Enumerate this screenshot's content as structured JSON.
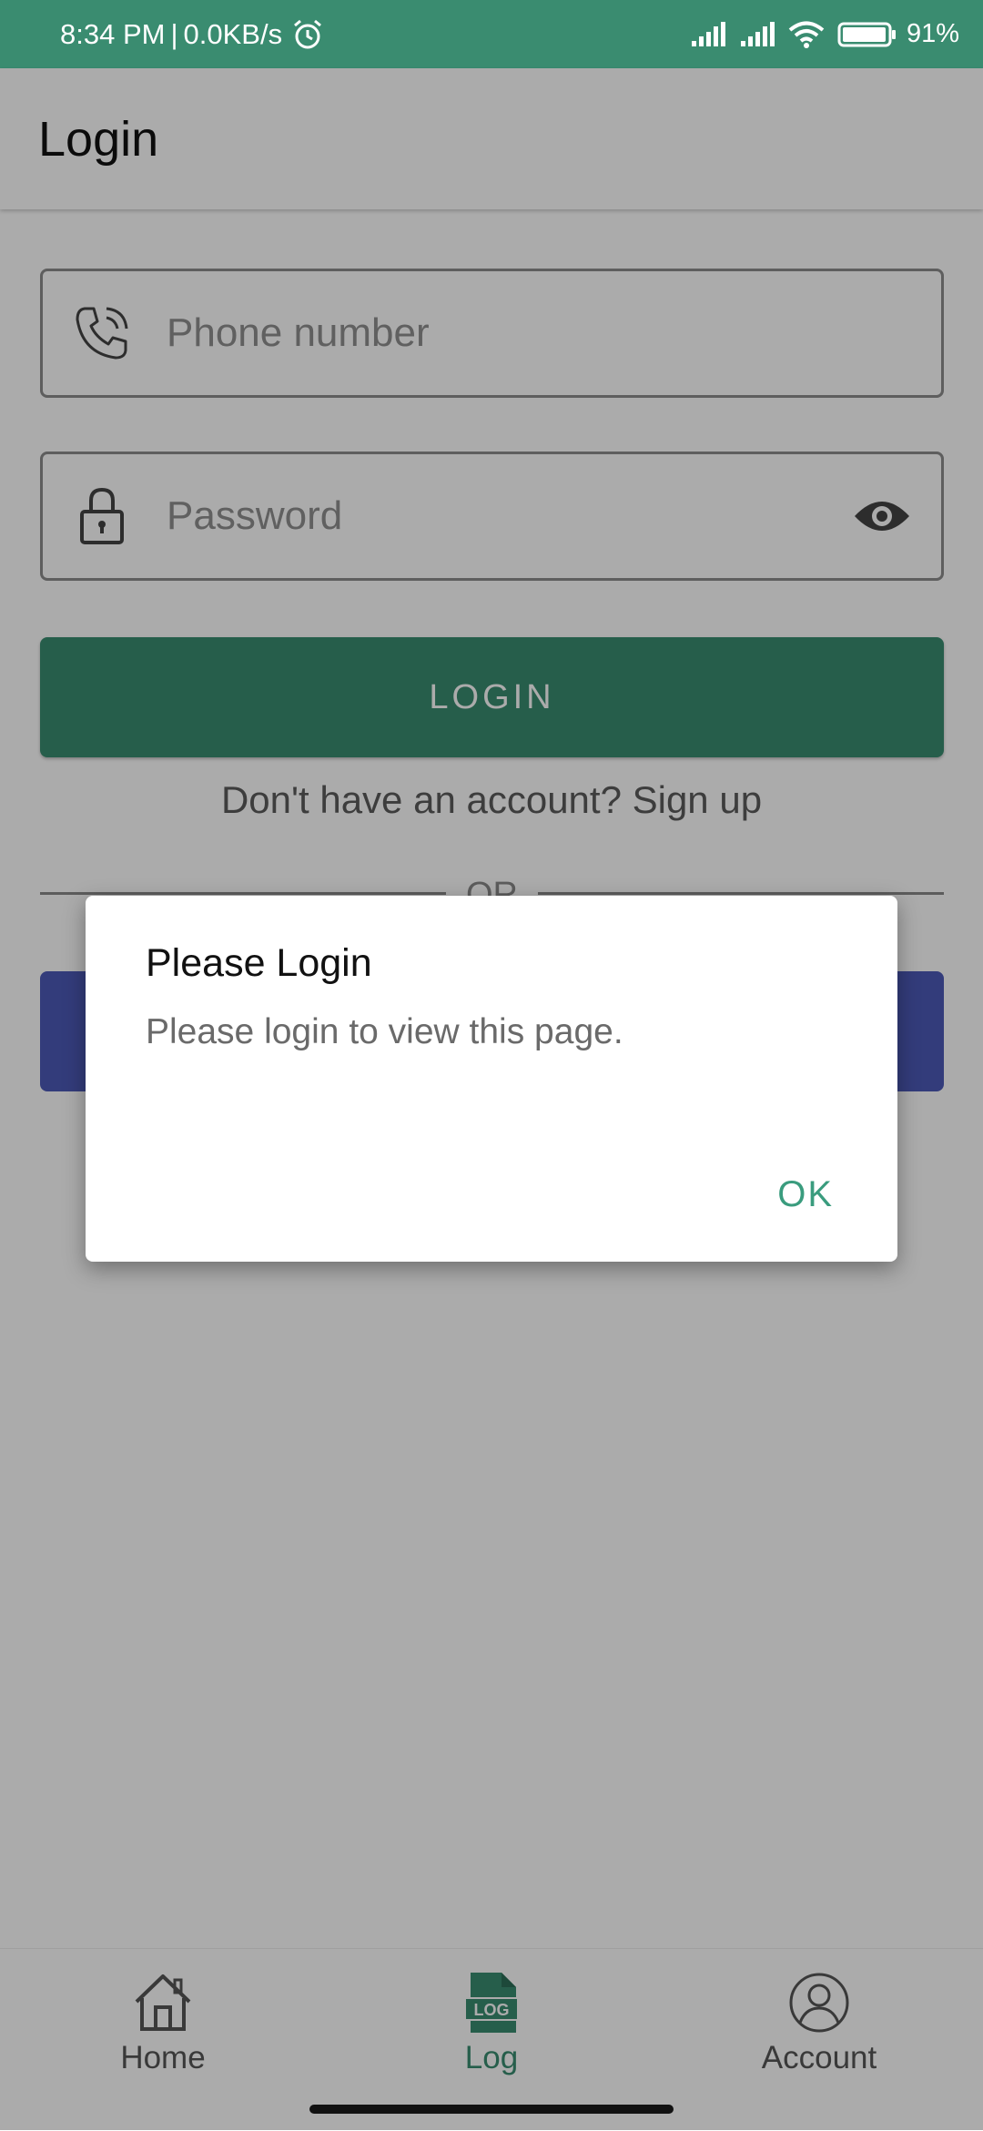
{
  "status_bar": {
    "time": "8:34 PM",
    "separator": "|",
    "net_speed": "0.0KB/s",
    "battery": "91%"
  },
  "app_bar": {
    "title": "Login"
  },
  "form": {
    "phone_placeholder": "Phone number",
    "password_placeholder": "Password",
    "login_label": "LOGIN",
    "signup_text": "Don't have an account? Sign up",
    "or_text": "OR"
  },
  "dialog": {
    "title": "Please Login",
    "message": "Please login to view this page.",
    "ok_label": "OK"
  },
  "bottom_nav": {
    "items": [
      {
        "label": "Home",
        "icon": "home-icon",
        "active": false
      },
      {
        "label": "Log",
        "icon": "log-icon",
        "icon_text": "LOG",
        "active": true
      },
      {
        "label": "Account",
        "icon": "account-icon",
        "active": false
      }
    ]
  },
  "colors": {
    "accent": "#3a8c70",
    "secondary_button": "#4d5ab8",
    "dialog_ok": "#3a9c7e"
  }
}
